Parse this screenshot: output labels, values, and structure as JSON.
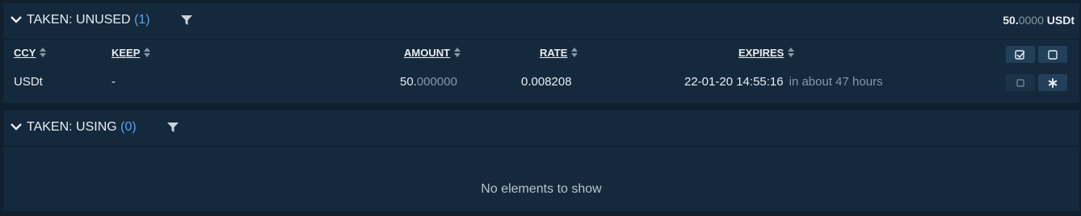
{
  "unused": {
    "title": "TAKEN: UNUSED",
    "count": "(1)",
    "total_int": "50.",
    "total_frac": "0000",
    "total_unit": " USDt",
    "columns": {
      "ccy": "CCY",
      "keep": "KEEP",
      "amount": "AMOUNT",
      "rate": "RATE",
      "expires": "EXPIRES"
    },
    "rows": [
      {
        "ccy": "USDt",
        "keep": "-",
        "amount_int": "50.",
        "amount_frac": "000000",
        "rate": "0.008208",
        "expires": "22-01-20 14:55:16",
        "expires_relative": "in about 47 hours"
      }
    ]
  },
  "using": {
    "title": "TAKEN: USING",
    "count": "(0)",
    "empty_text": "No elements to show"
  },
  "colors": {
    "background": "#0f1f2e",
    "panel": "#15293d",
    "accent_count": "#5aa2e6",
    "button": "#22405a"
  },
  "icons": [
    "chevron-down-icon",
    "filter-icon",
    "sort-icon",
    "checkbox-checked-icon",
    "checkbox-icon",
    "asterisk-icon"
  ]
}
